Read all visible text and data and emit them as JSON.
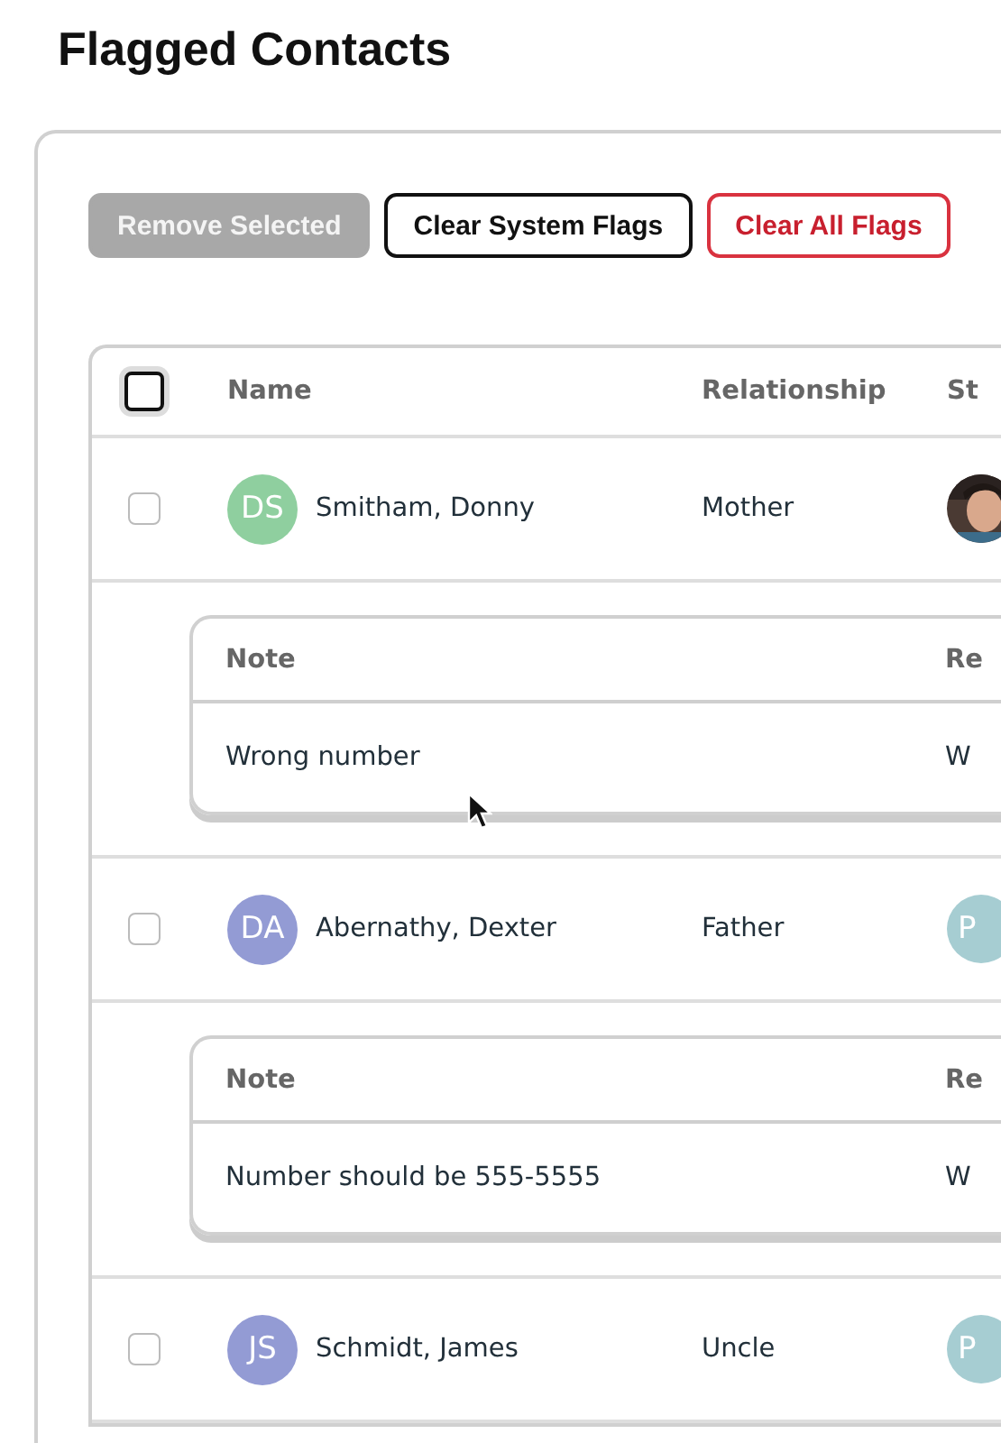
{
  "title": "Flagged Contacts",
  "buttons": [
    {
      "label": "Remove Selected",
      "kind": "disabled"
    },
    {
      "label": "Clear System Flags",
      "kind": "outline"
    },
    {
      "label": "Clear All Flags",
      "kind": "danger"
    }
  ],
  "table": {
    "select_all": {
      "checked": false
    },
    "columns": [
      "Name",
      "Relationship",
      "St"
    ],
    "rows": [
      {
        "checked": false,
        "initials": "DS",
        "color": "#8fcf9f",
        "name": "Smitham, Donny",
        "relationship": "Mother",
        "note": {
          "columns": [
            "Note",
            "Re"
          ],
          "text": "Wrong number",
          "column_2": "W"
        }
      },
      {
        "checked": false,
        "initials": "DA",
        "color": "#939bd4",
        "name": "Abernathy, Dexter",
        "relationship": "Father",
        "student": {
          "kind": "initial",
          "initial": "P",
          "color": "#a6cdd2"
        },
        "note": {
          "columns": [
            "Note",
            "Re"
          ],
          "text": "Number should be 555-5555",
          "column_2": "W"
        }
      },
      {
        "checked": false,
        "initials": "JS",
        "color": "#939bd4",
        "name": "Schmidt, James",
        "relationship": "Uncle",
        "student": {
          "kind": "initial",
          "initial": "P",
          "color": "#a6cdd2"
        }
      }
    ]
  }
}
